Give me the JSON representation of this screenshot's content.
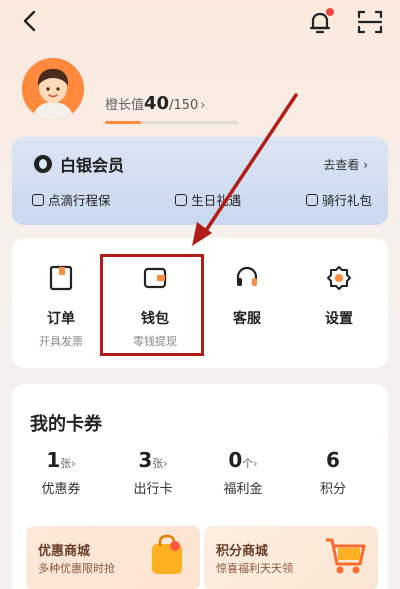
{
  "header": {
    "back_icon": "chevron-left-icon",
    "bell_icon": "bell-icon",
    "scan_icon": "scan-icon"
  },
  "profile": {
    "growth_label": "橙长值",
    "growth_value": "40",
    "growth_max": "/150",
    "growth_progress": 0.27
  },
  "member": {
    "name": "白银会员",
    "view_label": "去查看",
    "perks": [
      "点滴行程保",
      "生日礼遇",
      "骑行礼包"
    ]
  },
  "services": [
    {
      "label": "订单",
      "sub": "开具发票",
      "icon": "order-icon"
    },
    {
      "label": "钱包",
      "sub": "零钱提现",
      "icon": "wallet-icon"
    },
    {
      "label": "客服",
      "sub": "",
      "icon": "headset-icon"
    },
    {
      "label": "设置",
      "sub": "",
      "icon": "settings-icon"
    }
  ],
  "cards": {
    "title": "我的卡券",
    "stats": [
      {
        "value": "1",
        "unit": "张",
        "name": "优惠券"
      },
      {
        "value": "3",
        "unit": "张",
        "name": "出行卡"
      },
      {
        "value": "0",
        "unit": "个",
        "name": "福利金"
      },
      {
        "value": "6",
        "unit": "",
        "name": "积分"
      }
    ],
    "malls": [
      {
        "title": "优惠商城",
        "sub": "多种优惠限时抢"
      },
      {
        "title": "积分商城",
        "sub": "惊喜福利天天领"
      }
    ]
  },
  "colors": {
    "accent": "#ff8b3d",
    "highlight": "#b21e17"
  }
}
